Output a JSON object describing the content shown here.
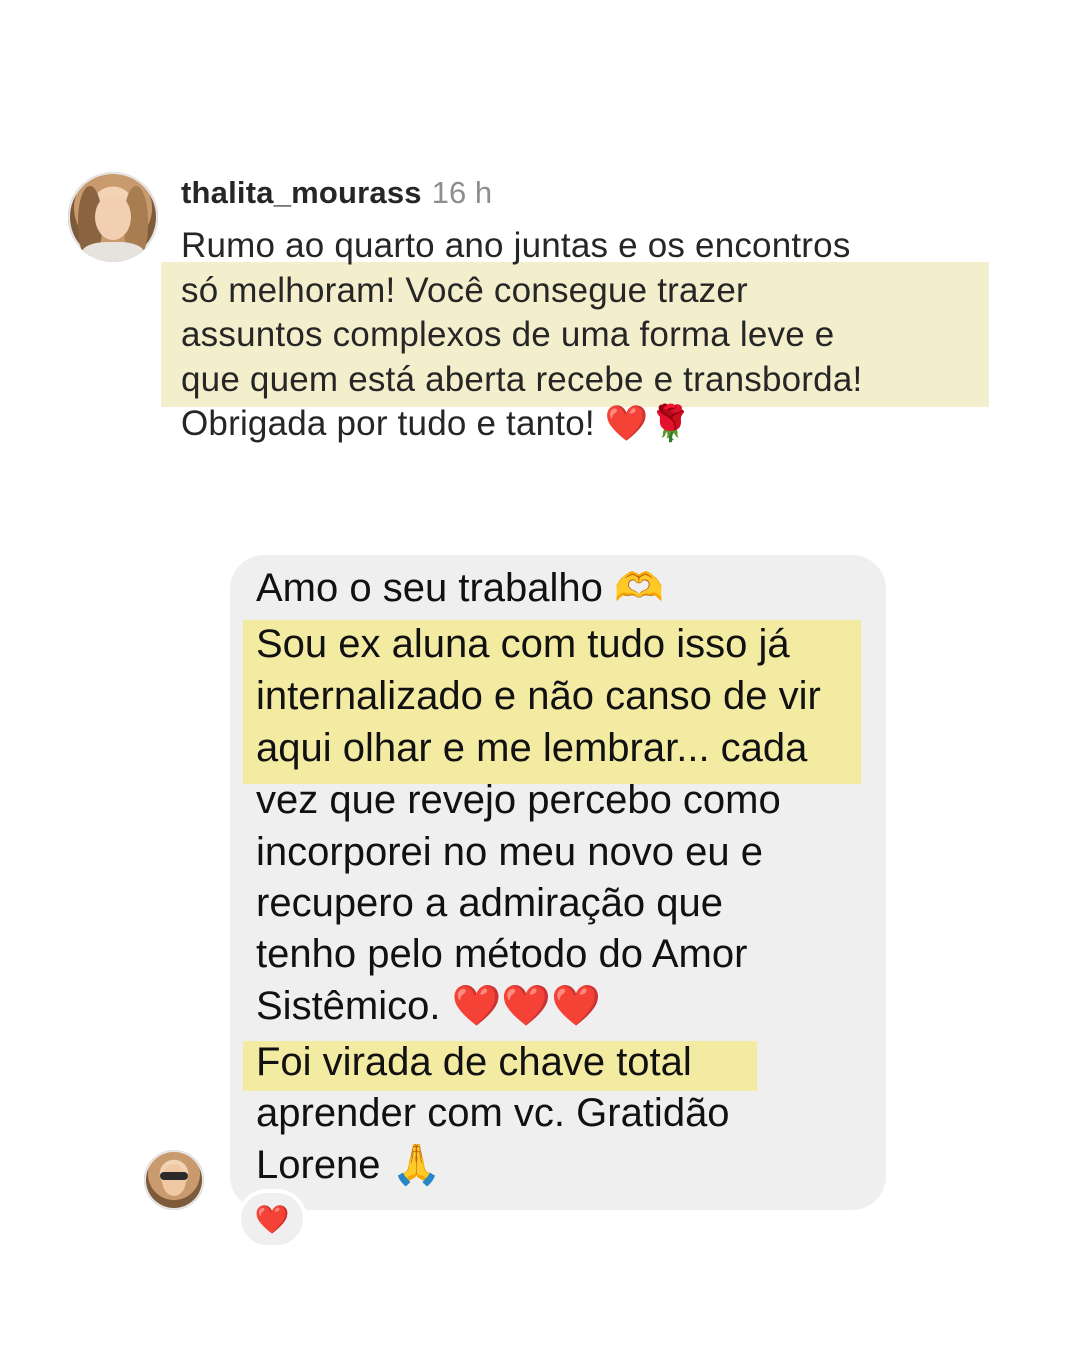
{
  "comment": {
    "username": "thalita_mourass",
    "time": "16 h",
    "lines": [
      "Rumo ao quarto ano juntas e os encontros",
      "só melhoram! Você consegue trazer",
      "assuntos complexos de uma forma leve e",
      "que quem está aberta recebe e transborda!",
      "Obrigada por tudo e tanto!"
    ],
    "end_emojis": "❤️🌹"
  },
  "message": {
    "lines": [
      "Amo o seu trabalho 🫶",
      "Sou ex aluna com tudo isso já",
      "internalizado e não canso de vir",
      "aqui olhar e me lembrar... cada",
      "vez que revejo percebo como",
      "incorporei no meu novo eu e",
      "recupero a admiração que",
      "tenho pelo método do Amor",
      "Sistêmico. ❤️❤️❤️",
      "Foi virada de chave total",
      "aprender com vc. Gratidão",
      "Lorene 🙏"
    ],
    "reaction": "❤️"
  },
  "colors": {
    "comment_highlight": "#f3efcd",
    "message_highlight": "#f4eba3",
    "bubble": "#efefef",
    "heart": "#e0102a",
    "timestamp": "#8e8e8e"
  },
  "icons": {
    "comment_avatar": "profile-photo-woman",
    "message_avatar": "profile-photo-woman-sunglasses",
    "reaction": "heart-icon"
  }
}
